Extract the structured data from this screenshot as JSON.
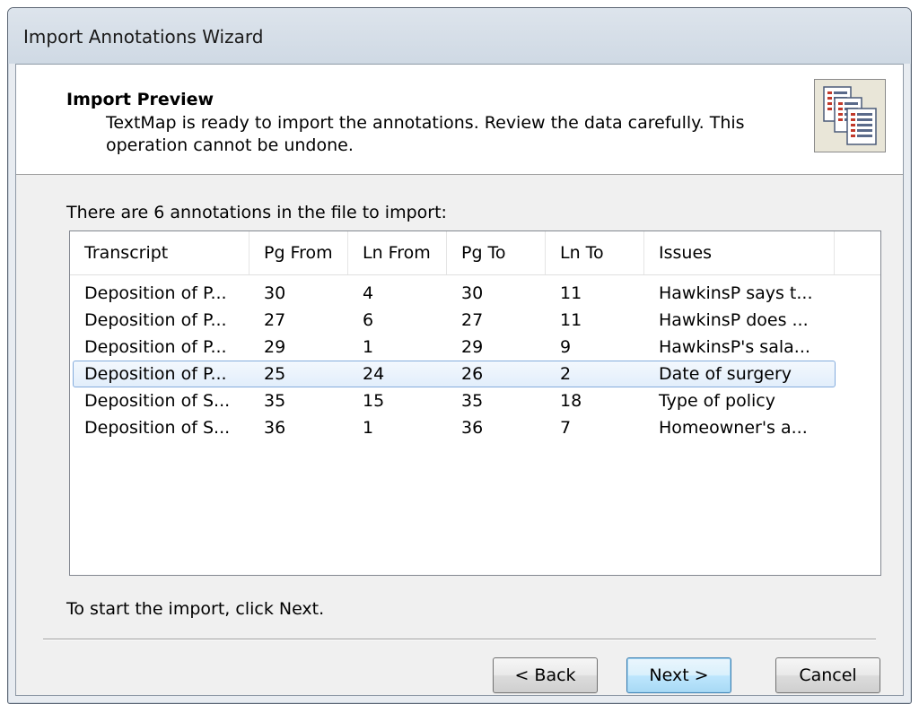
{
  "window": {
    "title": "Import Annotations Wizard"
  },
  "header": {
    "title": "Import Preview",
    "description": "TextMap is ready to import the annotations. Review the data carefully. This operation cannot be undone."
  },
  "caption": "There are 6 annotations in the file to import:",
  "table": {
    "columns": [
      "Transcript",
      "Pg From",
      "Ln From",
      "Pg To",
      "Ln To",
      "Issues"
    ],
    "rows": [
      [
        "Deposition of P...",
        "30",
        "4",
        "30",
        "11",
        "HawkinsP says t..."
      ],
      [
        "Deposition of P...",
        "27",
        "6",
        "27",
        "11",
        "HawkinsP does ..."
      ],
      [
        "Deposition of P...",
        "29",
        "1",
        "29",
        "9",
        "HawkinsP's sala..."
      ],
      [
        "Deposition of P...",
        "25",
        "24",
        "26",
        "2",
        "Date of surgery"
      ],
      [
        "Deposition of S...",
        "35",
        "15",
        "35",
        "18",
        "Type of policy"
      ],
      [
        "Deposition of S...",
        "36",
        "1",
        "36",
        "7",
        "Homeowner's a..."
      ]
    ],
    "selected_row": 3
  },
  "footer_text": "To start the import, click Next.",
  "buttons": {
    "back": "< Back",
    "next": "Next >",
    "cancel": "Cancel"
  },
  "icons": {
    "header_icon": "documents-icon"
  }
}
